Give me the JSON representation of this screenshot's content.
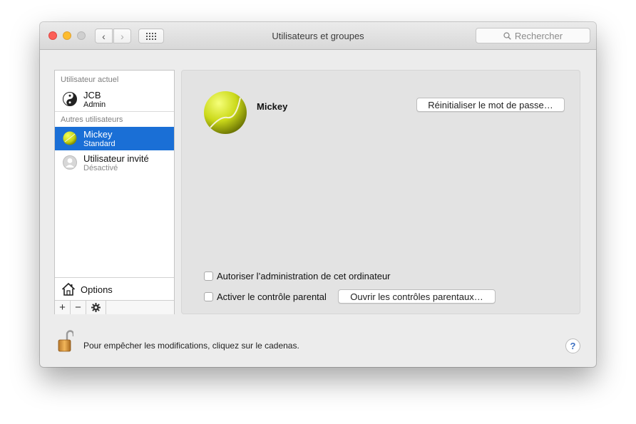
{
  "window": {
    "title": "Utilisateurs et groupes",
    "search_placeholder": "Rechercher"
  },
  "sidebar": {
    "current_user_header": "Utilisateur actuel",
    "current_user": {
      "name": "JCB",
      "role": "Admin",
      "icon": "yin-yang-icon"
    },
    "other_users_header": "Autres utilisateurs",
    "other_users": [
      {
        "name": "Mickey",
        "role": "Standard",
        "icon": "tennis-ball-icon",
        "selected": true
      },
      {
        "name": "Utilisateur invité",
        "role": "Désactivé",
        "icon": "guest-user-icon",
        "selected": false
      }
    ],
    "options_label": "Options",
    "toolbar": {
      "add": "+",
      "remove": "−",
      "settings": "✱"
    }
  },
  "detail": {
    "user_name": "Mickey",
    "reset_password_label": "Réinitialiser le mot de passe…",
    "allow_admin_label": "Autoriser l’administration de cet ordinateur",
    "allow_admin_checked": false,
    "parental_control_label": "Activer le contrôle parental",
    "parental_control_checked": false,
    "open_parental_label": "Ouvrir les contrôles parentaux…"
  },
  "footer": {
    "lock_text": "Pour empêcher les modifications, cliquez sur le cadenas.",
    "help_label": "?"
  },
  "colors": {
    "selection": "#1a6fd6",
    "close": "#fc5f57",
    "minimize": "#fdbc2e",
    "ball": "#d8e61c"
  }
}
